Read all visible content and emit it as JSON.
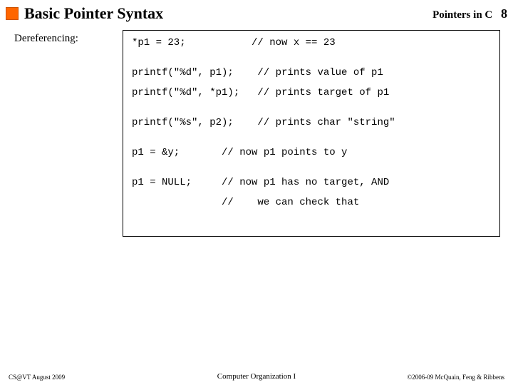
{
  "header": {
    "title": "Basic Pointer Syntax",
    "right_label": "Pointers in C",
    "page_number": "8"
  },
  "subhead": "Dereferencing:",
  "code": "*p1 = 23;           // now x == 23\n\n\nprintf(\"%d\", p1);    // prints value of p1\n\nprintf(\"%d\", *p1);   // prints target of p1\n\n\nprintf(\"%s\", p2);    // prints char \"string\"\n\n\np1 = &y;       // now p1 points to y\n\n\np1 = NULL;     // now p1 has no target, AND\n\n               //    we can check that",
  "footer": {
    "left": "CS@VT August 2009",
    "center": "Computer Organization I",
    "right": "©2006-09 McQuain, Feng & Ribbens"
  }
}
